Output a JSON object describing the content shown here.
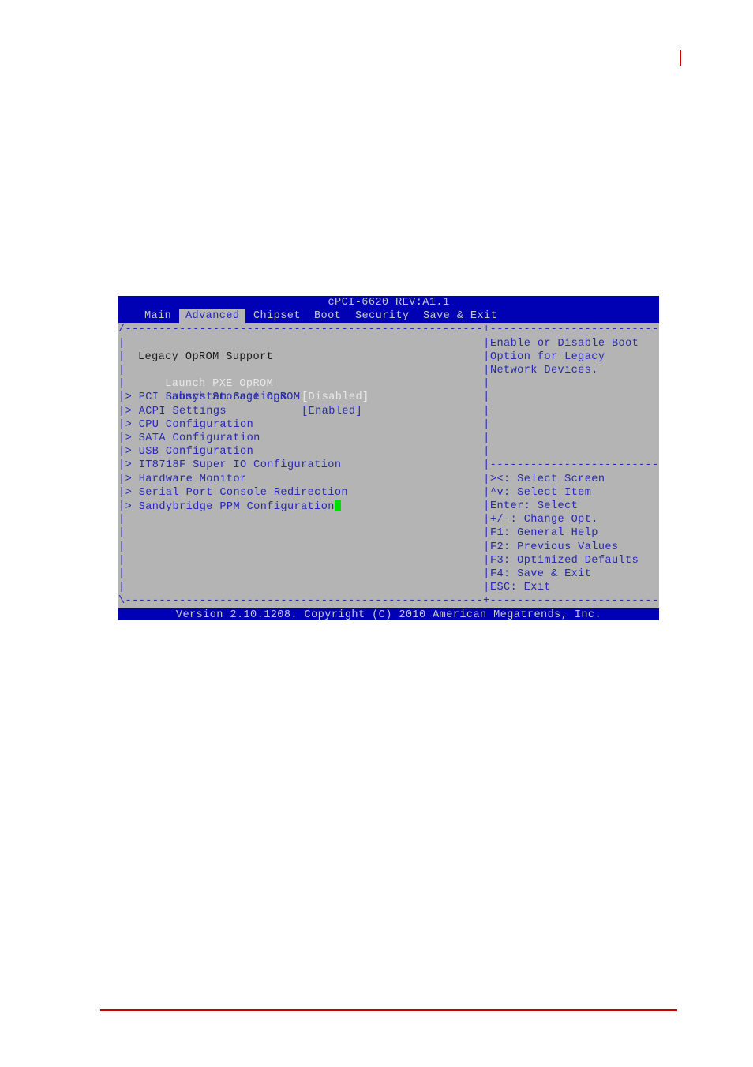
{
  "page": {
    "accent_color": "#cc0000"
  },
  "bios": {
    "title": "cPCI-6620 REV:A1.1",
    "tabs": [
      {
        "label": "Main",
        "active": false
      },
      {
        "label": "Advanced",
        "active": true
      },
      {
        "label": "Chipset",
        "active": false
      },
      {
        "label": "Boot",
        "active": false
      },
      {
        "label": "Security",
        "active": false
      },
      {
        "label": "Save & Exit",
        "active": false
      }
    ],
    "section_heading": "Legacy OpROM Support",
    "options": [
      {
        "label": "Launch PXE OpROM",
        "value": "[Disabled]",
        "selected": true
      },
      {
        "label": "Launch Storage OpROM",
        "value": "[Enabled]",
        "selected": false
      }
    ],
    "submenus": [
      "PCI Subsystem Settings",
      "ACPI Settings",
      "CPU Configuration",
      "SATA Configuration",
      "USB Configuration",
      "IT8718F Super IO Configuration",
      "Hardware Monitor",
      "Serial Port Console Redirection",
      "Sandybridge PPM Configuration"
    ],
    "submenu_marker": ">",
    "help_text": [
      "Enable or Disable Boot",
      "Option for Legacy",
      "Network Devices."
    ],
    "key_help": [
      "><: Select Screen",
      "^v: Select Item",
      "Enter: Select",
      "+/-: Change Opt.",
      "F1: General Help",
      "F2: Previous Values",
      "F3: Optimized Defaults",
      "F4: Save & Exit",
      "ESC: Exit"
    ],
    "footer": "Version 2.10.1208. Copyright (C) 2010 American Megatrends, Inc.",
    "colors": {
      "bar": "#0000b4",
      "panel": "#b4b4b4",
      "text": "#2828b4",
      "highlight": "#e8e8e8",
      "cursor": "#00e000"
    }
  }
}
